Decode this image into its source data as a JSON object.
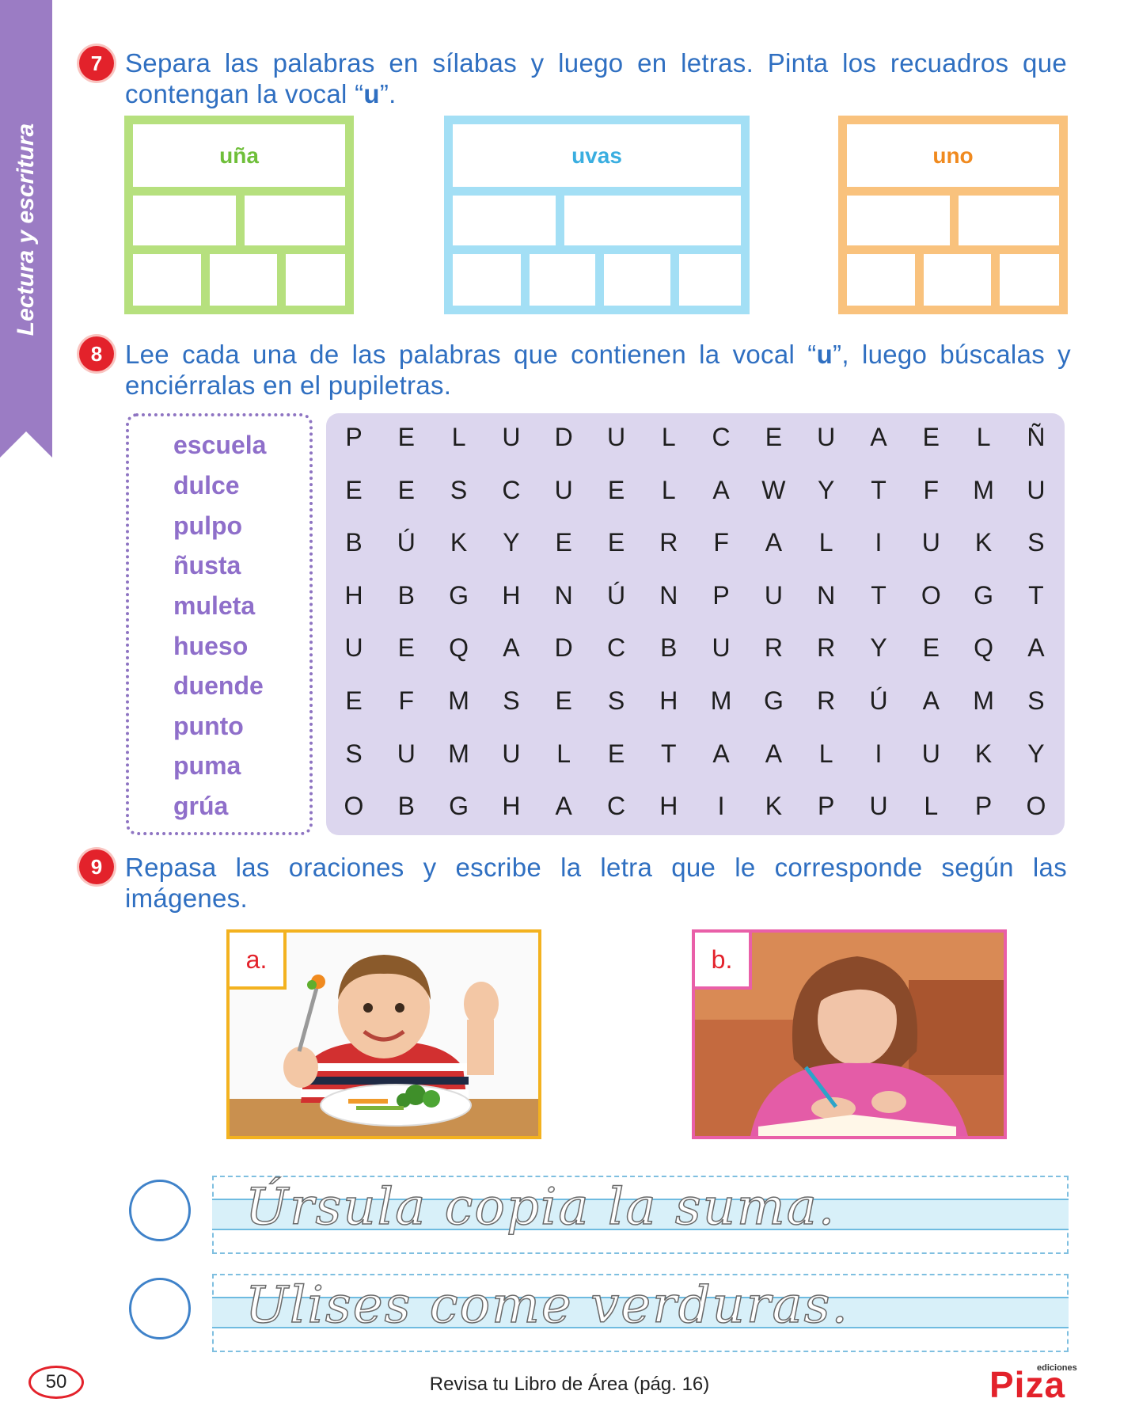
{
  "side_tab": {
    "label": "Lectura y escritura"
  },
  "ex7": {
    "number": "7",
    "text_before": "Separa las palabras en sílabas y luego en letras. Pinta los recuadros que contengan la vocal “",
    "highlight": "u",
    "text_after": "”.",
    "boxes": [
      {
        "word": "uña",
        "color": "#b6e07e",
        "word_color": "#6fbf3a"
      },
      {
        "word": "uvas",
        "color": "#a3dff5",
        "word_color": "#3aaee0"
      },
      {
        "word": "uno",
        "color": "#f9c27d",
        "word_color": "#f08a1f"
      }
    ]
  },
  "ex8": {
    "number": "8",
    "text_before": "Lee cada una de las palabras que contienen la vocal “",
    "highlight": "u",
    "text_after": "”, luego búscalas y enciérralas en el pupiletras.",
    "words": [
      "escuela",
      "dulce",
      "pulpo",
      "ñusta",
      "muleta",
      "hueso",
      "duende",
      "punto",
      "puma",
      "grúa"
    ],
    "grid": [
      [
        "P",
        "E",
        "L",
        "U",
        "D",
        "U",
        "L",
        "C",
        "E",
        "U",
        "A",
        "E",
        "L",
        "Ñ"
      ],
      [
        "E",
        "E",
        "S",
        "C",
        "U",
        "E",
        "L",
        "A",
        "W",
        "Y",
        "T",
        "F",
        "M",
        "U"
      ],
      [
        "B",
        "Ú",
        "K",
        "Y",
        "E",
        "E",
        "R",
        "F",
        "A",
        "L",
        "I",
        "U",
        "K",
        "S"
      ],
      [
        "H",
        "B",
        "G",
        "H",
        "N",
        "Ú",
        "N",
        "P",
        "U",
        "N",
        "T",
        "O",
        "G",
        "T"
      ],
      [
        "U",
        "E",
        "Q",
        "A",
        "D",
        "C",
        "B",
        "U",
        "R",
        "R",
        "Y",
        "E",
        "Q",
        "A"
      ],
      [
        "E",
        "F",
        "M",
        "S",
        "E",
        "S",
        "H",
        "M",
        "G",
        "R",
        "Ú",
        "A",
        "M",
        "S"
      ],
      [
        "S",
        "U",
        "M",
        "U",
        "L",
        "E",
        "T",
        "A",
        "A",
        "L",
        "I",
        "U",
        "K",
        "Y"
      ],
      [
        "O",
        "B",
        "G",
        "H",
        "A",
        "C",
        "H",
        "I",
        "K",
        "P",
        "U",
        "L",
        "P",
        "O"
      ]
    ]
  },
  "ex9": {
    "number": "9",
    "text": "Repasa las oraciones y escribe la letra que le corresponde según las imágenes.",
    "images": [
      {
        "label": "a.",
        "border_color": "#f3b21f"
      },
      {
        "label": "b.",
        "border_color": "#e95fa8"
      }
    ],
    "sentences": [
      "Úrsula copia la suma.",
      "Ulises come verduras."
    ]
  },
  "footer": {
    "page_number": "50",
    "note": "Revisa tu Libro de Área (pág. 16)",
    "logo_top": "ediciones",
    "logo": "Piza"
  }
}
